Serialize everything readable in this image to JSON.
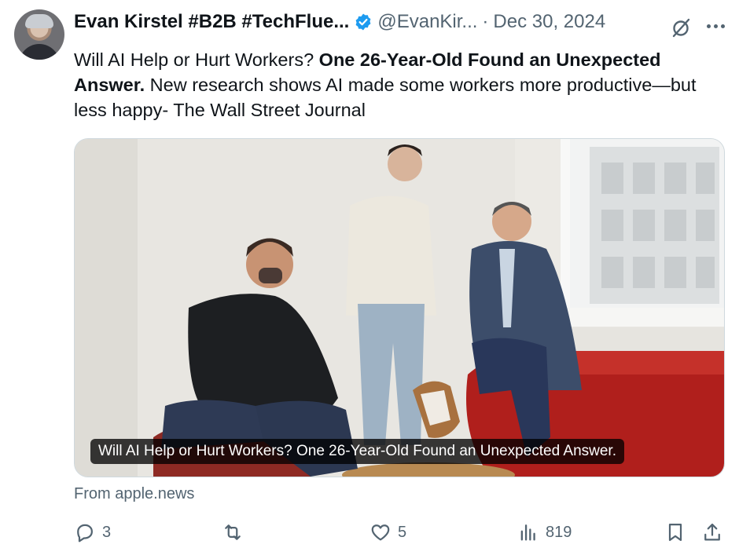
{
  "tweet": {
    "author_name": "Evan Kirstel #B2B #TechFlue...",
    "handle": "@EvanKir...",
    "separator": "·",
    "date": "Dec 30, 2024",
    "text_intro": "Will AI Help or Hurt Workers? ",
    "text_bold": "One 26-Year-Old Found an Unexpected Answer.",
    "text_rest": " New research shows AI made some workers more productive—but less happy- The Wall Street Journal"
  },
  "card": {
    "caption": "Will AI Help or Hurt Workers? One 26-Year-Old Found an Unexpected Answer.",
    "source": "From apple.news"
  },
  "actions": {
    "replies": "3",
    "reposts": "",
    "likes": "5",
    "views": "819"
  },
  "colors": {
    "text_primary": "#0f1419",
    "text_secondary": "#536471",
    "verified_blue": "#1d9bf0"
  },
  "icons": [
    "verified-badge-icon",
    "grok-icon",
    "more-icon",
    "reply-icon",
    "repost-icon",
    "like-icon",
    "views-icon",
    "bookmark-icon",
    "share-icon"
  ]
}
